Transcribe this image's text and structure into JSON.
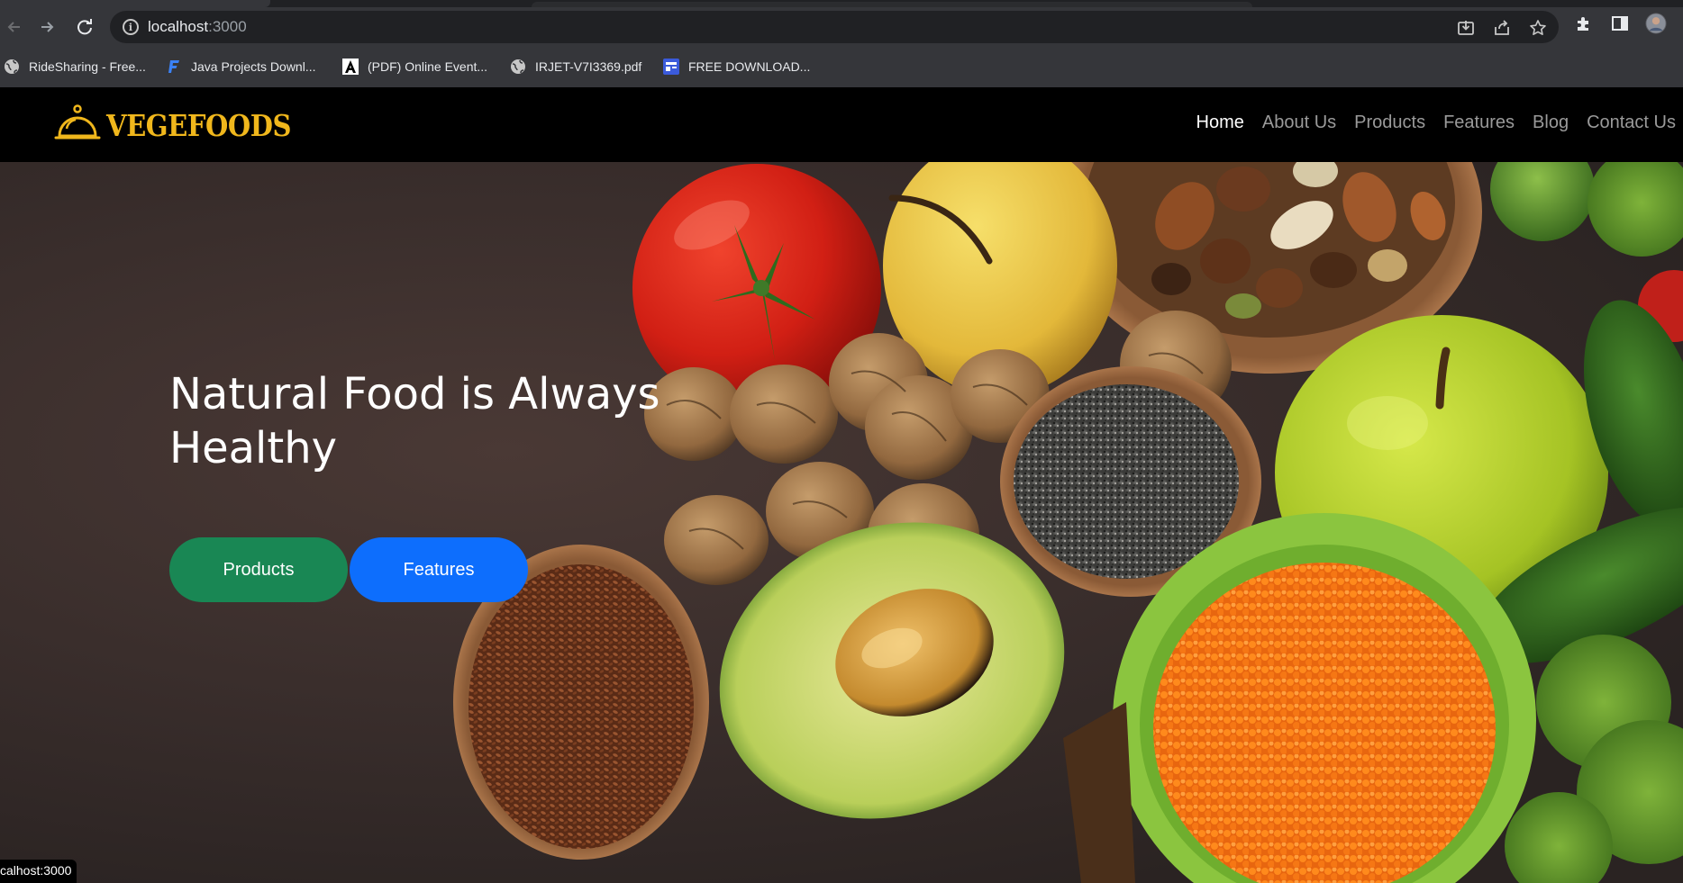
{
  "browser": {
    "url_host": "localhost",
    "url_port": ":3000",
    "icons": [
      "back-icon",
      "forward-icon",
      "reload-icon",
      "info-icon",
      "install-icon",
      "share-icon",
      "star-icon",
      "extensions-icon",
      "side-panel-icon",
      "profile-avatar"
    ],
    "bookmarks": [
      {
        "label": "RideSharing - Free...",
        "icon": "globe-icon"
      },
      {
        "label": "Java Projects Downl...",
        "icon": "f-logo-icon"
      },
      {
        "label": "(PDF) Online Event...",
        "icon": "academia-icon"
      },
      {
        "label": "IRJET-V7I3369.pdf",
        "icon": "globe-icon"
      },
      {
        "label": "FREE DOWNLOAD...",
        "icon": "site-icon"
      }
    ]
  },
  "site": {
    "logo_text": "VEGEFOODS",
    "logo_icon": "cloche-icon",
    "nav": [
      "Home",
      "About Us",
      "Products",
      "Features",
      "Blog",
      "Contact Us"
    ],
    "active_nav": "Home"
  },
  "hero": {
    "title": "Natural Food is Always Healthy",
    "buttons": {
      "products": "Products",
      "features": "Features"
    }
  },
  "status_bar": {
    "url": "calhost:3000"
  },
  "colors": {
    "brand_gold": "#f0b71c",
    "btn_green": "#198754",
    "btn_blue": "#0d6efd",
    "chrome_bg": "#35363a",
    "header_bg": "#000000"
  }
}
